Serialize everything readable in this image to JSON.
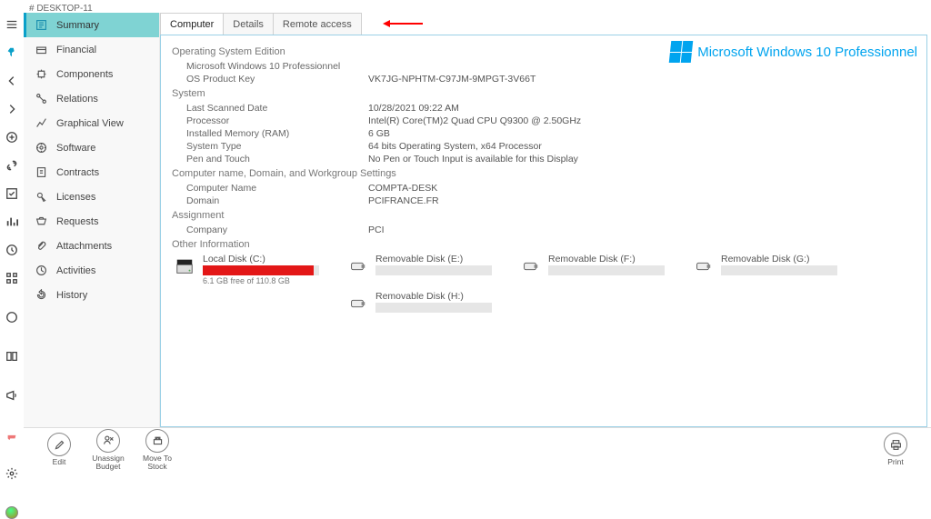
{
  "header": {
    "breadcrumb": "# DESKTOP-11"
  },
  "sidebar": {
    "items": [
      {
        "label": "Summary",
        "active": true
      },
      {
        "label": "Financial",
        "active": false
      },
      {
        "label": "Components",
        "active": false
      },
      {
        "label": "Relations",
        "active": false
      },
      {
        "label": "Graphical View",
        "active": false
      },
      {
        "label": "Software",
        "active": false
      },
      {
        "label": "Contracts",
        "active": false
      },
      {
        "label": "Licenses",
        "active": false
      },
      {
        "label": "Requests",
        "active": false
      },
      {
        "label": "Attachments",
        "active": false
      },
      {
        "label": "Activities",
        "active": false
      },
      {
        "label": "History",
        "active": false
      }
    ]
  },
  "tabs": {
    "items": [
      "Computer",
      "Details",
      "Remote access"
    ],
    "active": 0
  },
  "brand": {
    "text": "Microsoft Windows 10 Professionnel"
  },
  "sections": {
    "os_edition": {
      "title": "Operating System Edition",
      "rows": [
        {
          "label": "Microsoft Windows 10 Professionnel",
          "value": ""
        },
        {
          "label": "OS Product Key",
          "value": "VK7JG-NPHTM-C97JM-9MPGT-3V66T"
        }
      ]
    },
    "system": {
      "title": "System",
      "rows": [
        {
          "label": "Last Scanned Date",
          "value": "10/28/2021 09:22 AM"
        },
        {
          "label": "Processor",
          "value": "Intel(R) Core(TM)2 Quad CPU Q9300 @ 2.50GHz"
        },
        {
          "label": "Installed Memory (RAM)",
          "value": "6 GB"
        },
        {
          "label": "System Type",
          "value": "64 bits Operating System, x64 Processor"
        },
        {
          "label": "Pen and Touch",
          "value": "No Pen or Touch Input is available for this Display"
        }
      ]
    },
    "cndw": {
      "title": "Computer name, Domain, and Workgroup Settings",
      "rows": [
        {
          "label": "Computer Name",
          "value": "COMPTA-DESK"
        },
        {
          "label": "Domain",
          "value": "PCIFRANCE.FR"
        }
      ]
    },
    "assignment": {
      "title": "Assignment",
      "rows": [
        {
          "label": "Company",
          "value": "PCI"
        }
      ]
    },
    "other": {
      "title": "Other Information"
    }
  },
  "disks": [
    {
      "name": "Local Disk (C:)",
      "type": "local",
      "usage_text": "6.1 GB free of 110.8 GB",
      "used_pct": 95
    },
    {
      "name": "Removable Disk (E:)",
      "type": "removable",
      "usage_text": "",
      "used_pct": 0
    },
    {
      "name": "Removable Disk (F:)",
      "type": "removable",
      "usage_text": "",
      "used_pct": 0
    },
    {
      "name": "Removable Disk (G:)",
      "type": "removable",
      "usage_text": "",
      "used_pct": 0
    },
    {
      "name": "Removable Disk (H:)",
      "type": "removable",
      "usage_text": "",
      "used_pct": 0
    }
  ],
  "bottom_actions": {
    "left": [
      {
        "label": "Edit"
      },
      {
        "label": "Unassign\nBudget"
      },
      {
        "label": "Move To\nStock"
      }
    ],
    "right": [
      {
        "label": "Print"
      }
    ]
  }
}
